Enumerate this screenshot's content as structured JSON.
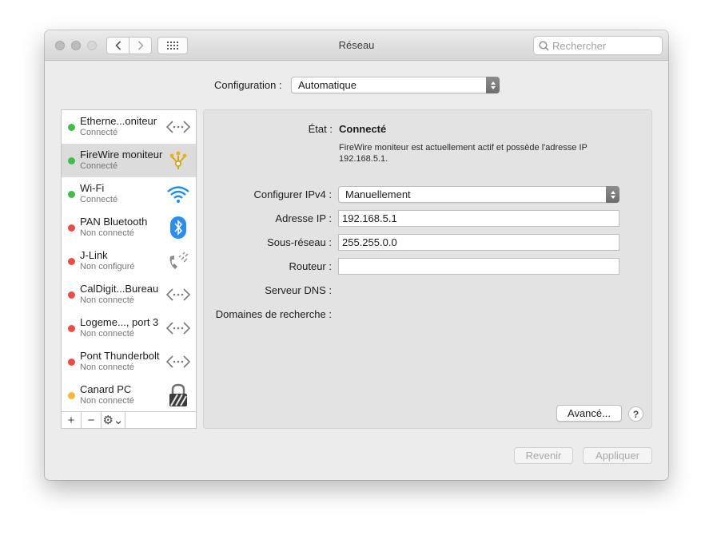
{
  "window": {
    "title": "Réseau",
    "search_placeholder": "Rechercher"
  },
  "toolbar": {
    "back": "‹",
    "forward": "›"
  },
  "configuration": {
    "label": "Configuration :",
    "value": "Automatique"
  },
  "services": [
    {
      "name": "Etherne...oniteur",
      "status": "Connecté",
      "status_color": "#3fbf4a",
      "icon": "ethernet-icon"
    },
    {
      "name": "FireWire moniteur",
      "status": "Connecté",
      "status_color": "#3fbf4a",
      "icon": "firewire-icon"
    },
    {
      "name": "Wi-Fi",
      "status": "Connecté",
      "status_color": "#3fbf4a",
      "icon": "wifi-icon"
    },
    {
      "name": "PAN Bluetooth",
      "status": "Non connecté",
      "status_color": "#f04a47",
      "icon": "bluetooth-icon"
    },
    {
      "name": "J-Link",
      "status": "Non configuré",
      "status_color": "#f04a47",
      "icon": "phone-icon"
    },
    {
      "name": "CalDigit...Bureau",
      "status": "Non connecté",
      "status_color": "#f04a47",
      "icon": "ethernet-icon"
    },
    {
      "name": "Logeme..., port 3",
      "status": "Non connecté",
      "status_color": "#f04a47",
      "icon": "ethernet-icon"
    },
    {
      "name": "Pont Thunderbolt",
      "status": "Non connecté",
      "status_color": "#f04a47",
      "icon": "ethernet-icon"
    },
    {
      "name": "Canard PC",
      "status": "Non connecté",
      "status_color": "#f5b83a",
      "icon": "vpn-lock-icon"
    }
  ],
  "sidebar_toolbar": {
    "add": "+",
    "remove": "−",
    "action": "⚙⌄"
  },
  "detail": {
    "state_label": "État :",
    "state_value": "Connecté",
    "state_description": "FireWire moniteur est actuellement actif et possède l'adresse IP 192.168.5.1.",
    "ipv4_label": "Configurer IPv4 :",
    "ipv4_value": "Manuellement",
    "ip_label": "Adresse IP :",
    "ip_value": "192.168.5.1",
    "subnet_label": "Sous-réseau :",
    "subnet_value": "255.255.0.0",
    "router_label": "Routeur :",
    "router_value": "",
    "dns_label": "Serveur DNS :",
    "search_domains_label": "Domaines de recherche :",
    "advanced_button": "Avancé...",
    "help_button": "?"
  },
  "footer": {
    "revert": "Revenir",
    "apply": "Appliquer"
  }
}
